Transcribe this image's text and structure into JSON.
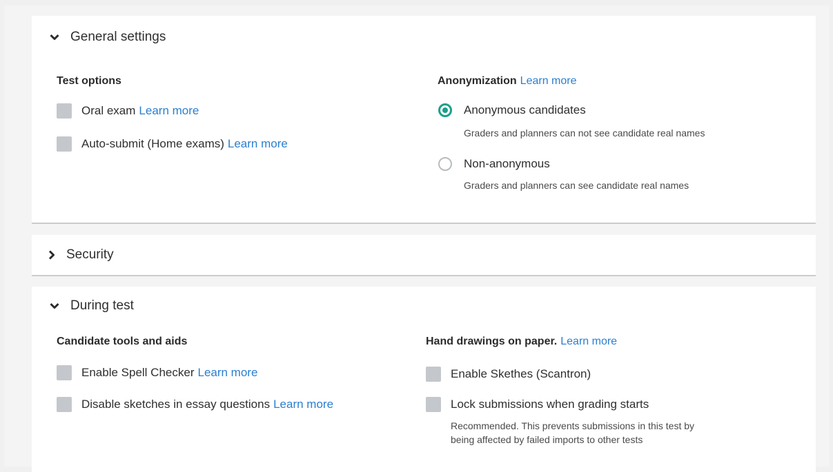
{
  "general": {
    "title": "General settings",
    "test_options": {
      "title": "Test options",
      "items": [
        {
          "label": "Oral exam",
          "link": "Learn more",
          "checked": false
        },
        {
          "label": "Auto-submit (Home exams)",
          "link": "Learn more",
          "checked": false
        }
      ]
    },
    "anonymization": {
      "title": "Anonymization",
      "link": "Learn more",
      "options": [
        {
          "label": "Anonymous candidates",
          "description": "Graders and planners can not see candidate real names",
          "selected": true
        },
        {
          "label": "Non-anonymous",
          "description": "Graders and planners can see candidate real names",
          "selected": false
        }
      ]
    }
  },
  "security": {
    "title": "Security"
  },
  "during_test": {
    "title": "During test",
    "tools": {
      "title": "Candidate tools and aids",
      "items": [
        {
          "label": "Enable Spell Checker",
          "link": "Learn more",
          "checked": false
        },
        {
          "label": "Disable sketches in essay questions",
          "link": "Learn more",
          "checked": false
        }
      ]
    },
    "hand_drawings": {
      "title": "Hand drawings on paper.",
      "link": "Learn more",
      "items": [
        {
          "label": "Enable Skethes (Scantron)",
          "checked": false
        },
        {
          "label": "Lock submissions when grading starts",
          "checked": false,
          "description_line1": "Recommended. This prevents submissions in this test by",
          "description_line2": "being affected by failed imports to other tests"
        }
      ]
    }
  },
  "colors": {
    "accent": "#1aa08a",
    "link": "#2a7fd0",
    "checkbox": "#c4c7cb"
  }
}
